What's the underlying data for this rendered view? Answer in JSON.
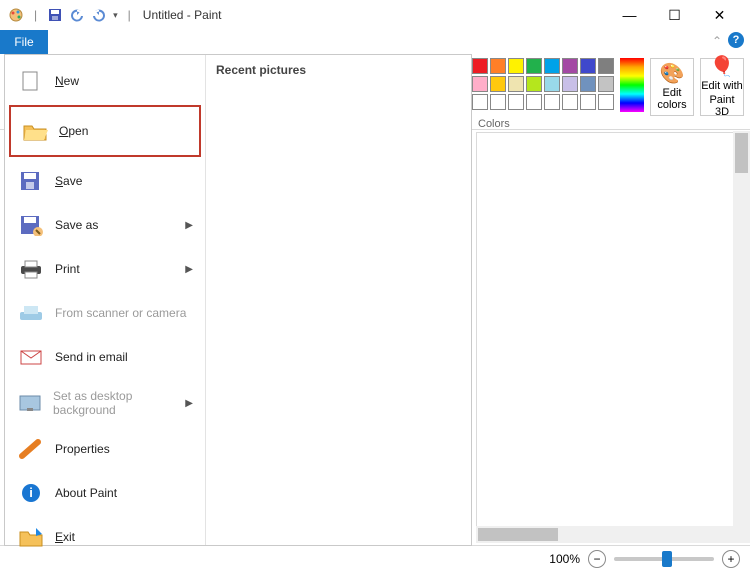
{
  "titlebar": {
    "document_name": "Untitled",
    "app_name": "Paint",
    "separator": " - "
  },
  "tabs": {
    "file": "File"
  },
  "file_menu": {
    "items": [
      {
        "id": "new",
        "label": "New",
        "accel": "N"
      },
      {
        "id": "open",
        "label": "Open",
        "accel": "O",
        "highlighted": true
      },
      {
        "id": "save",
        "label": "Save",
        "accel": "S"
      },
      {
        "id": "save-as",
        "label": "Save as",
        "submenu": true
      },
      {
        "id": "print",
        "label": "Print",
        "submenu": true
      },
      {
        "id": "scanner",
        "label": "From scanner or camera",
        "disabled": true
      },
      {
        "id": "email",
        "label": "Send in email"
      },
      {
        "id": "wallpaper",
        "label": "Set as desktop background",
        "submenu": true,
        "disabled": true
      },
      {
        "id": "properties",
        "label": "Properties"
      },
      {
        "id": "about",
        "label": "About Paint"
      },
      {
        "id": "exit",
        "label": "Exit",
        "accel": "E"
      }
    ],
    "recent_header": "Recent pictures"
  },
  "ribbon": {
    "colors_label": "Colors",
    "edit_colors": "Edit colors",
    "paint3d_line1": "Edit with",
    "paint3d_line2": "Paint 3D",
    "swatch_rows": [
      [
        "#000000",
        "#ed1c24",
        "#ff7f27",
        "#fff200",
        "#22b14c",
        "#00a2e8",
        "#a349a4",
        "#3f48cc",
        "#7f7f7f"
      ],
      [
        "#ffffff",
        "#ffaec9",
        "#ffc90e",
        "#efe4b0",
        "#b5e61d",
        "#99d9ea",
        "#c8bfe7",
        "#7092be",
        "#c3c3c3"
      ],
      [
        "#ffffff",
        "#ffffff",
        "#ffffff",
        "#ffffff",
        "#ffffff",
        "#ffffff",
        "#ffffff",
        "#ffffff",
        "#ffffff"
      ]
    ]
  },
  "statusbar": {
    "zoom_pct": "100%",
    "minus": "−",
    "plus": "+"
  },
  "icons": {
    "paint": "paint-icon",
    "save": "save-icon",
    "undo": "undo-icon",
    "redo": "redo-icon",
    "dropdown": "dropdown-icon"
  }
}
